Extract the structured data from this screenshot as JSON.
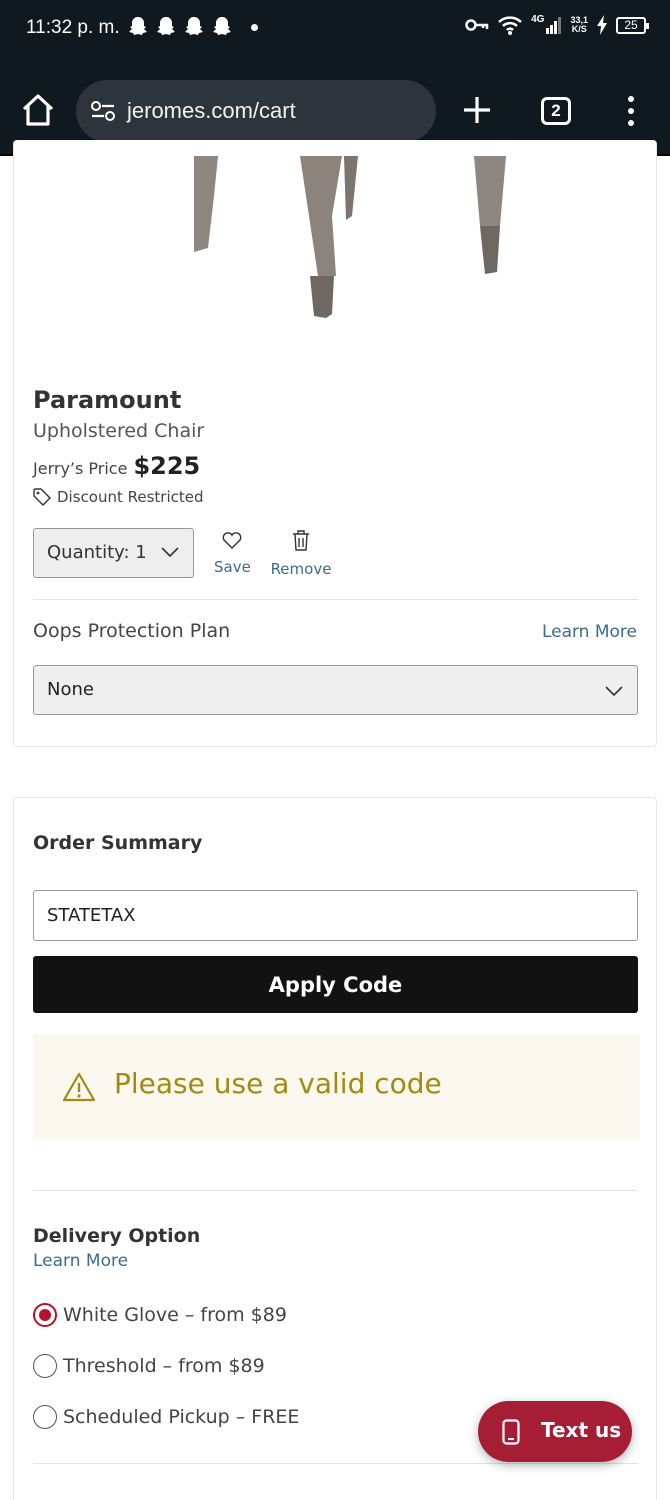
{
  "status_bar": {
    "time": "11:32 p. m.",
    "network": "4G",
    "speed_value": "33,1",
    "speed_unit": "K/S",
    "battery": "25"
  },
  "browser": {
    "url": "jeromes.com/cart",
    "tab_count": "2"
  },
  "product": {
    "name": "Paramount",
    "subtitle": "Upholstered Chair",
    "price_label": "Jerry’s Price",
    "price": "$225",
    "discount_note": "Discount Restricted",
    "quantity_label": "Quantity: 1",
    "save_label": "Save",
    "remove_label": "Remove",
    "protection_title": "Oops Protection Plan",
    "protection_learn_more": "Learn More",
    "protection_selected": "None"
  },
  "order_summary": {
    "title": "Order Summary",
    "promo_code_value": "STATETAX",
    "apply_label": "Apply Code",
    "alert_message": "Please use a valid code",
    "delivery_title": "Delivery Option",
    "delivery_learn_more": "Learn More",
    "delivery_options": [
      {
        "label": "White Glove – from $89",
        "selected": true
      },
      {
        "label": "Threshold – from $89",
        "selected": false
      },
      {
        "label": "Scheduled Pickup – FREE",
        "selected": false
      }
    ]
  },
  "chat": {
    "label": "Text us"
  },
  "colors": {
    "accent_red": "#a61e35",
    "link_blue": "#3d6c8f",
    "alert_text": "#a38a12"
  }
}
